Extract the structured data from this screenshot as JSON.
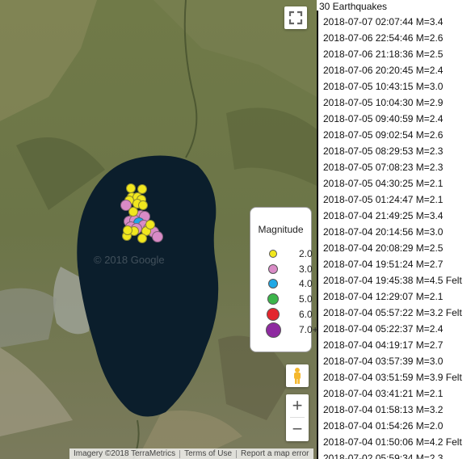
{
  "map": {
    "watermark": "© 2018 Google",
    "controls": {
      "fullscreen_icon": "fullscreen-icon",
      "pegman_icon": "pegman-icon",
      "zoom_in_label": "+",
      "zoom_out_label": "−"
    },
    "attribution": {
      "imagery": "Imagery ©2018 TerraMetrics",
      "terms": "Terms of Use",
      "report": "Report a map error"
    },
    "legend": {
      "title": "Magnitude",
      "items": [
        {
          "label": "2.0",
          "color": "#f1e71e"
        },
        {
          "label": "3.0",
          "color": "#d98bc6"
        },
        {
          "label": "4.0",
          "color": "#1fa8e6"
        },
        {
          "label": "5.0",
          "color": "#3cb54b"
        },
        {
          "label": "6.0",
          "color": "#e3262d"
        },
        {
          "label": "7.0+",
          "color": "#8e2aa0"
        }
      ]
    },
    "colors": {
      "lake": "#0b1e2c",
      "land": "#6f7a4e",
      "urban": "#9a9e91"
    }
  },
  "list": {
    "title": "30 Earthquakes",
    "items": [
      "2018-07-07 02:07:44 M=3.4",
      "2018-07-06 22:54:46 M=2.6",
      "2018-07-06 21:18:36 M=2.5",
      "2018-07-06 20:20:45 M=2.4",
      "2018-07-05 10:43:15 M=3.0",
      "2018-07-05 10:04:30 M=2.9",
      "2018-07-05 09:40:59 M=2.4",
      "2018-07-05 09:02:54 M=2.6",
      "2018-07-05 08:29:53 M=2.3",
      "2018-07-05 07:08:23 M=2.3",
      "2018-07-05 04:30:25 M=2.1",
      "2018-07-05 01:24:47 M=2.1",
      "2018-07-04 21:49:25 M=3.4",
      "2018-07-04 20:14:56 M=3.0",
      "2018-07-04 20:08:29 M=2.5",
      "2018-07-04 19:51:24 M=2.7",
      "2018-07-04 19:45:38 M=4.5 Felt",
      "2018-07-04 12:29:07 M=2.1",
      "2018-07-04 05:57:22 M=3.2 Felt",
      "2018-07-04 05:22:37 M=2.4",
      "2018-07-04 04:19:17 M=2.7",
      "2018-07-04 03:57:39 M=3.0",
      "2018-07-04 03:51:59 M=3.9 Felt",
      "2018-07-04 03:41:21 M=2.1",
      "2018-07-04 01:58:13 M=3.2",
      "2018-07-04 01:54:26 M=2.0",
      "2018-07-04 01:50:06 M=4.2 Felt",
      "2018-07-02 05:59:34 M=2.3"
    ]
  }
}
